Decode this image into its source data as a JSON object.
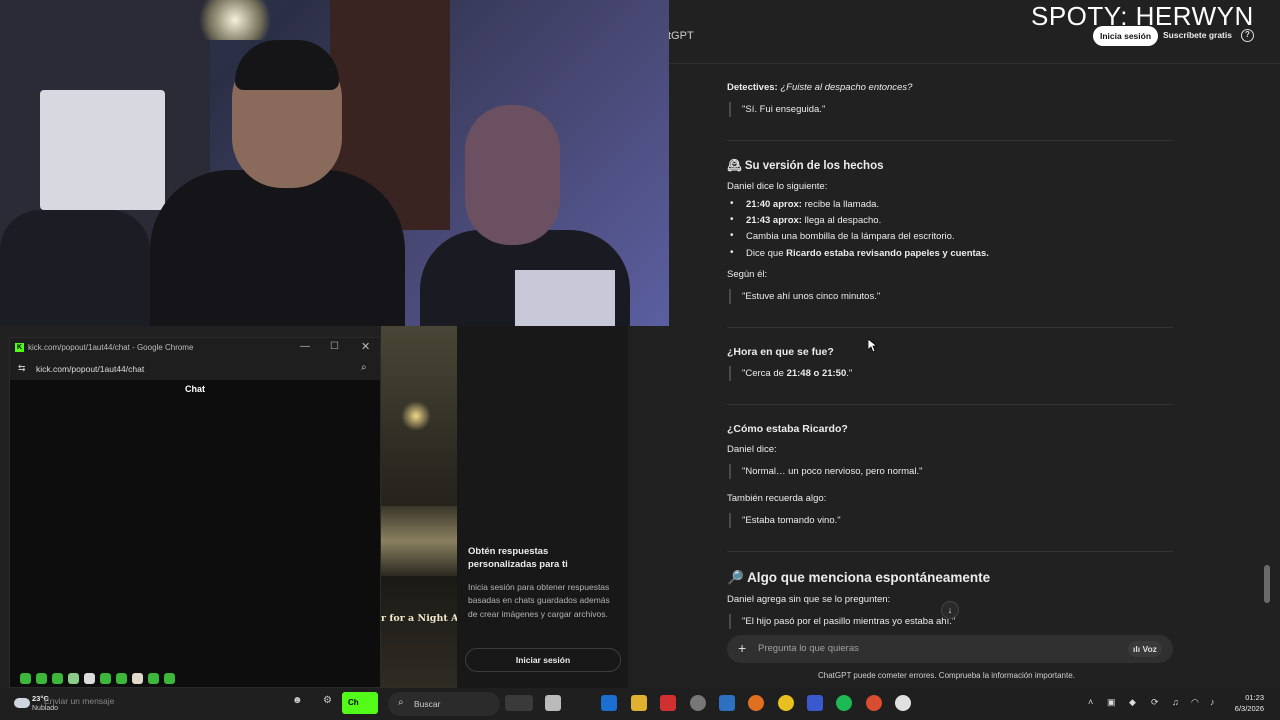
{
  "overlay": {
    "spoty": "SPOTY: HERWYN"
  },
  "chatgpt": {
    "header_title": "tGPT",
    "login_button": "Inicia sesión",
    "signup_button": "Suscríbete gratis",
    "help_icon": "?",
    "messages": {
      "detectives_label": "Detectives:",
      "detectives_q": "¿Fuiste al despacho entonces?",
      "q1": "\"Sí. Fui enseguida.\"",
      "sec1_emoji": "🕰",
      "sec1_title": "Su versión de los hechos",
      "sec1_intro": "Daniel dice lo siguiente:",
      "b1_bold": "21:40 aprox:",
      "b1_rest": " recibe la llamada.",
      "b2_bold": "21:43 aprox:",
      "b2_rest": " llega al despacho.",
      "b3": "Cambia una bombilla de la lámpara del escritorio.",
      "b4_a": "Dice que ",
      "b4_bold": "Ricardo estaba revisando papeles y cuentas.",
      "segun": "Según él:",
      "q2": "\"Estuve ahí unos cinco minutos.\"",
      "sec2_title": "¿Hora en que se fue?",
      "q3_a": "\"Cerca de ",
      "q3_bold": "21:48 o 21:50",
      "q3_b": ".\"",
      "sec3_title": "¿Cómo estaba Ricardo?",
      "daniel_dice": "Daniel dice:",
      "q4": "\"Normal… un poco nervioso, pero normal.\"",
      "tambien": "También recuerda algo:",
      "q5": "\"Estaba tomando vino.\"",
      "sec4_emoji": "🔎",
      "sec4_title": "Algo que menciona espontáneamente",
      "sec4_intro": "Daniel agrega sin que se lo pregunten:",
      "q6": "\"El hijo pasó por el pasillo mientras yo estaba ahí.\""
    },
    "input_placeholder": "Pregunta lo que quieras",
    "voice_button": "Voz",
    "disclaimer": "ChatGPT puede cometer errores. Comprueba la información importante."
  },
  "popout": {
    "window_title": "kick.com/popout/1aut44/chat - Google Chrome",
    "url": "kick.com/popout/1aut44/chat",
    "chat_label": "Chat",
    "message_placeholder": "Enviar un mensaje"
  },
  "video": {
    "caption": "r for a Night A"
  },
  "promo": {
    "title": "Obtén respuestas personalizadas para ti",
    "body": "Inicia sesión para obtener respuestas basadas en chats guardados además de crear imágenes y cargar archivos.",
    "button": "Iniciar sesión"
  },
  "taskbar": {
    "weather_temp": "23°C",
    "weather_cond": "Nublado",
    "kick_button": "Ch",
    "search_text": "Buscar",
    "time": "01:23",
    "date": "6/3/2026"
  }
}
